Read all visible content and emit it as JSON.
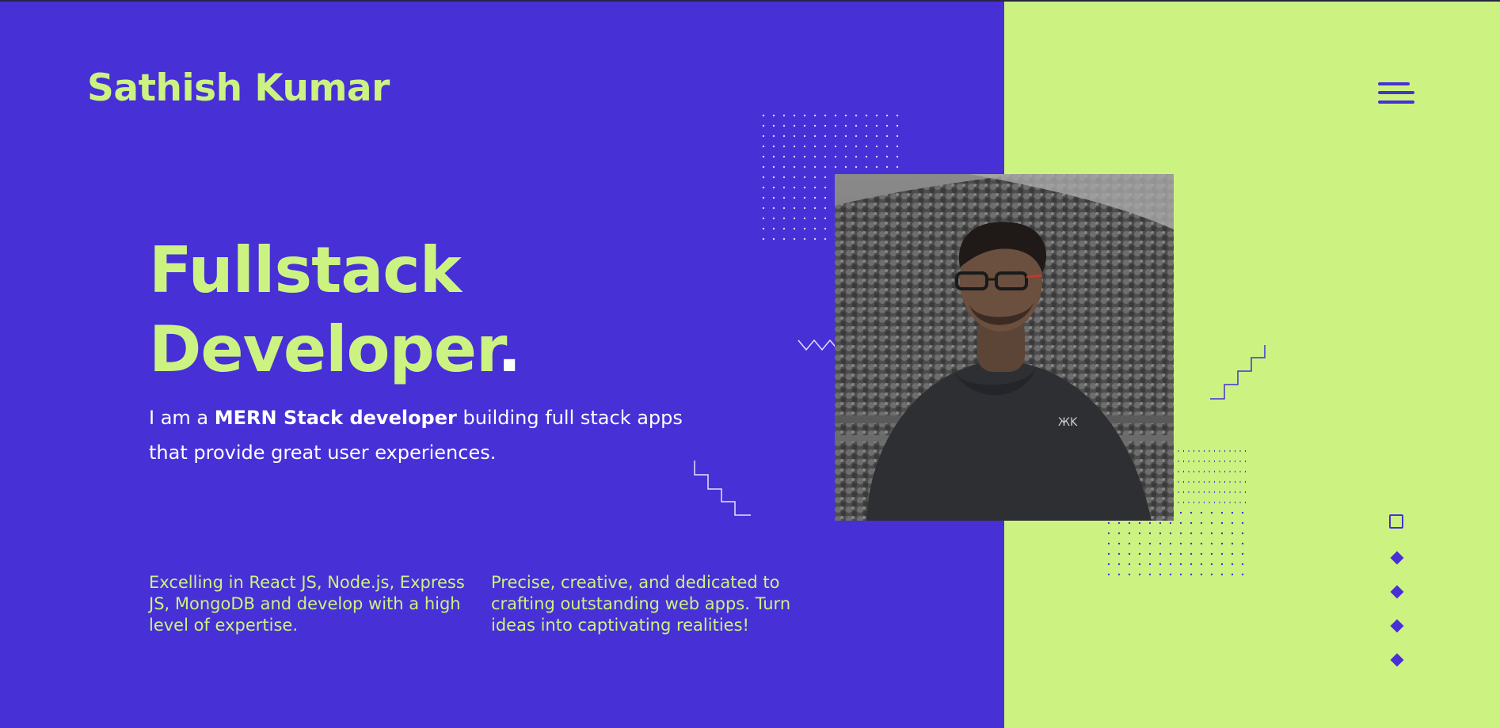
{
  "header": {
    "brand": "Sathish Kumar",
    "menu_icon": "hamburger-menu-icon"
  },
  "hero": {
    "headline_line1": "Fullstack",
    "headline_line2": "Developer",
    "headline_dot": ".",
    "intro_prefix": "I am a ",
    "intro_strong": "MERN Stack developer",
    "intro_suffix": " building full stack apps that provide great user experiences."
  },
  "features": [
    {
      "text": "Excelling in React JS, Node.js, Express JS, MongoDB and develop with a high level of expertise."
    },
    {
      "text": "Precise, creative, and dedicated to crafting outstanding web apps. Turn ideas into captivating realities!"
    }
  ],
  "photo": {
    "alt": "portrait-photo"
  },
  "colors": {
    "primary": "#4730d6",
    "accent": "#ccf381",
    "text_light": "#ffffff"
  },
  "decorations": {
    "slider_markers": [
      "square-outline-icon",
      "diamond-icon",
      "diamond-icon",
      "diamond-icon",
      "diamond-icon"
    ]
  }
}
